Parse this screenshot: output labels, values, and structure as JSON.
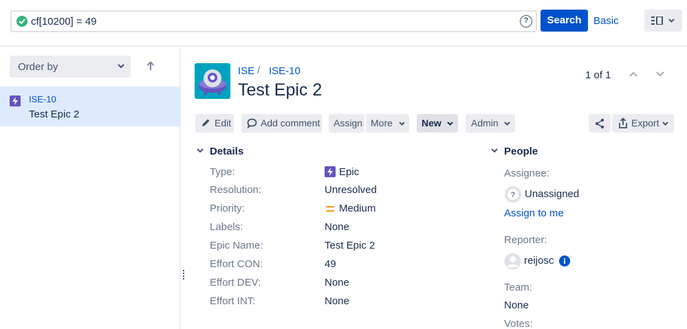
{
  "search": {
    "query": "cf[10200] = 49",
    "help": "?",
    "button": "Search",
    "mode_link": "Basic"
  },
  "left_panel": {
    "order_by": "Order by",
    "issues": [
      {
        "key": "ISE-10",
        "summary": "Test Epic 2"
      }
    ]
  },
  "issue": {
    "project": "ISE",
    "separator": "/",
    "key": "ISE-10",
    "title": "Test Epic 2",
    "pager": "1 of 1"
  },
  "toolbar": {
    "edit": "Edit",
    "add_comment": "Add comment",
    "assign": "Assign",
    "more": "More",
    "new": "New",
    "admin": "Admin",
    "export": "Export"
  },
  "details": {
    "heading": "Details",
    "fields": [
      {
        "label": "Type:",
        "value": "Epic"
      },
      {
        "label": "Resolution:",
        "value": "Unresolved"
      },
      {
        "label": "Priority:",
        "value": "Medium"
      },
      {
        "label": "Labels:",
        "value": "None"
      },
      {
        "label": "Epic Name:",
        "value": "Test Epic 2"
      },
      {
        "label": "Effort CON:",
        "value": "49"
      },
      {
        "label": "Effort DEV:",
        "value": "None"
      },
      {
        "label": "Effort INT:",
        "value": "None"
      }
    ]
  },
  "people": {
    "heading": "People",
    "assignee_label": "Assignee:",
    "assignee_value": "Unassigned",
    "assign_to_me": "Assign to me",
    "reporter_label": "Reporter:",
    "reporter_value": "reijosc",
    "team_label": "Team:",
    "team_value": "None",
    "votes_label": "Votes:"
  },
  "colors": {
    "primary": "#0052cc",
    "success": "#36b37e",
    "epic": "#6554c0",
    "priority_medium": "#ff991f",
    "selected_row": "#deebff"
  }
}
